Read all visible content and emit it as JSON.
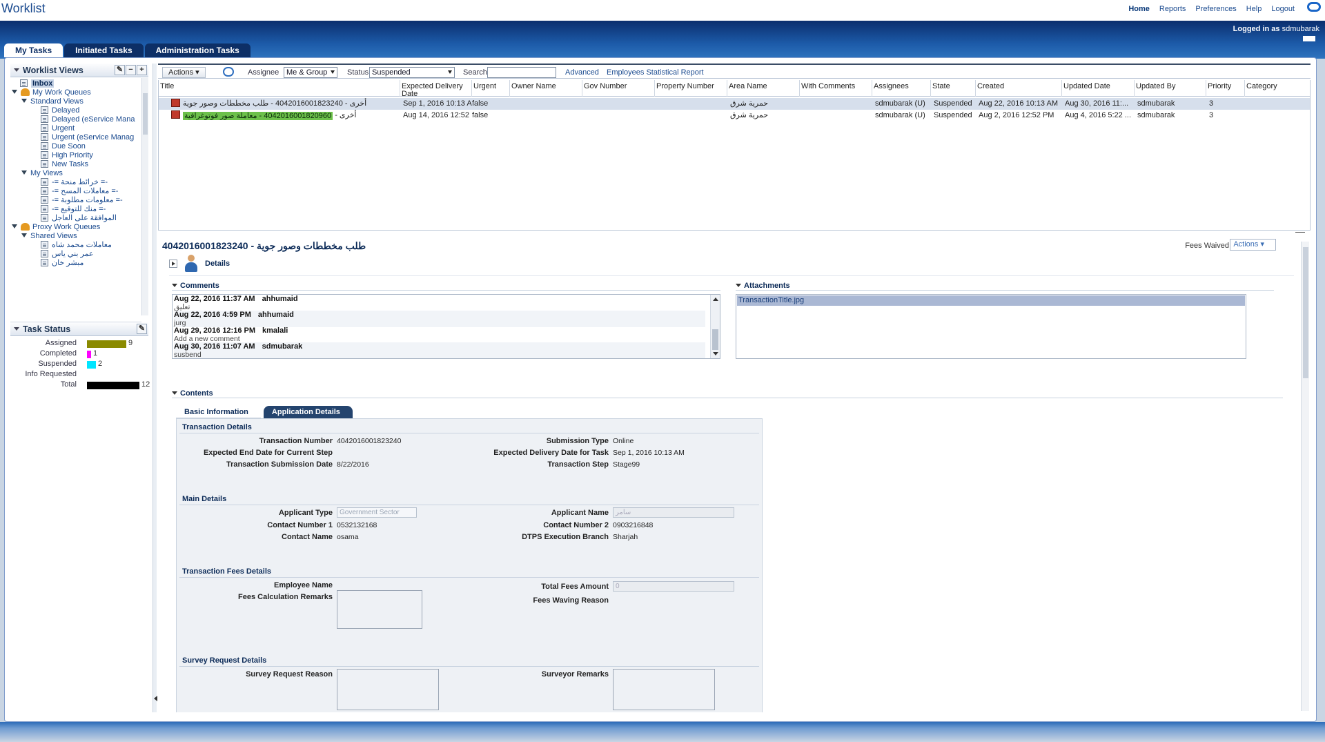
{
  "app": {
    "title": "Worklist",
    "top_links": [
      "Home",
      "Reports",
      "Preferences",
      "Help",
      "Logout"
    ],
    "logged_in_label": "Logged in as",
    "logged_in_user": "sdmubarak"
  },
  "main_tabs": [
    "My Tasks",
    "Initiated Tasks",
    "Administration Tasks"
  ],
  "worklist_views": {
    "title": "Worklist Views",
    "items": [
      {
        "label": "Inbox",
        "level": 1
      },
      {
        "label": "My Work Queues",
        "level": 0
      },
      {
        "label": "Standard Views",
        "level": 1
      },
      {
        "label": "Delayed",
        "level": 3
      },
      {
        "label": "Delayed (eService Mana",
        "level": 3
      },
      {
        "label": "Urgent",
        "level": 3
      },
      {
        "label": "Urgent (eService Manag",
        "level": 3
      },
      {
        "label": "Due Soon",
        "level": 3
      },
      {
        "label": "High Priority",
        "level": 3
      },
      {
        "label": "New Tasks",
        "level": 3
      },
      {
        "label": "My Views",
        "level": 1
      },
      {
        "label": "-= خرائط منحة =-",
        "level": 3
      },
      {
        "label": "-= معاملات المسح =-",
        "level": 3
      },
      {
        "label": "-= معلومات مطلوبة =-",
        "level": 3
      },
      {
        "label": "-= منك للتوقيع =-",
        "level": 3
      },
      {
        "label": "الموافقة على العاجل",
        "level": 3
      },
      {
        "label": "Proxy Work Queues",
        "level": 0
      },
      {
        "label": "Shared Views",
        "level": 1
      },
      {
        "label": "معاملات محمد شاه",
        "level": 3
      },
      {
        "label": "عمر بني ياس",
        "level": 3
      },
      {
        "label": "مبشر خان",
        "level": 3
      }
    ]
  },
  "task_status": {
    "title": "Task Status",
    "rows": [
      {
        "label": "Assigned",
        "count": "9",
        "color": "#8a8a00",
        "value": 9
      },
      {
        "label": "Completed",
        "count": "1",
        "color": "#ff00ff",
        "value": 1
      },
      {
        "label": "Suspended",
        "count": "2",
        "color": "#00e5ff",
        "value": 2
      },
      {
        "label": "Info Requested",
        "count": "",
        "color": "#000000",
        "value": 0
      },
      {
        "label": "Total",
        "count": "12",
        "color": "#000000",
        "value": 12
      }
    ]
  },
  "toolbar": {
    "actions_label": "Actions",
    "assignee_label": "Assignee",
    "assignee_value": "Me & Group",
    "status_label": "Status",
    "status_value": "Suspended",
    "search_label": "Search",
    "search_value": "",
    "advanced_link": "Advanced",
    "report_link": "Employees Statistical Report"
  },
  "task_table": {
    "columns": [
      "Title",
      "Expected Delivery Date",
      "Urgent",
      "Owner Name",
      "Gov Number",
      "Property Number",
      "Area Name",
      "With Comments",
      "Assignees",
      "State",
      "Created",
      "Updated Date",
      "Updated By",
      "Priority",
      "Category"
    ],
    "rows": [
      {
        "title_prefix": "أخرى",
        "title_main": "4042016001823240 - طلب مخططات وصور جوية",
        "expected": "Sep 1, 2016 10:13 AI",
        "urgent": "false",
        "area": "حمرية شرق",
        "assignees": "sdmubarak (U)",
        "state": "Suspended",
        "created": "Aug 22, 2016 10:13 AM",
        "updated": "Aug 30, 2016 11:...",
        "updated_by": "sdmubarak",
        "priority": "3"
      },
      {
        "title_prefix": "أخرى",
        "title_main": "4042016001820960 - معاملة صور فوتوغرافية",
        "expected": "Aug 14, 2016 12:52 I",
        "urgent": "false",
        "area": "حمرية شرق",
        "assignees": "sdmubarak (U)",
        "state": "Suspended",
        "created": "Aug 2, 2016 12:52 PM",
        "updated": "Aug 4, 2016 5:22 ...",
        "updated_by": "sdmubarak",
        "priority": "3"
      }
    ]
  },
  "detail": {
    "title": "4042016001823240 - طلب مخططات وصور جوية",
    "fees_waived_label": "Fees Waived",
    "actions_label": "Actions",
    "details_label": "Details",
    "comments_title": "Comments",
    "attachments_title": "Attachments",
    "comments": [
      {
        "date": "Aug 22, 2016 11:37 AM",
        "user": "ahhumaid",
        "text": "تعليق"
      },
      {
        "date": "Aug 22, 2016 4:59 PM",
        "user": "ahhumaid",
        "text": "jurg"
      },
      {
        "date": "Aug 29, 2016 12:16 PM",
        "user": "kmalali",
        "text": "Add a new comment"
      },
      {
        "date": "Aug 30, 2016 11:07 AM",
        "user": "sdmubarak",
        "text": "susbend"
      }
    ],
    "attachments": [
      "TransactionTitle.jpg"
    ],
    "contents_title": "Contents",
    "tabs": [
      "Basic Information",
      "Application Details"
    ]
  },
  "form": {
    "transaction_details": {
      "title": "Transaction Details",
      "transaction_number_label": "Transaction Number",
      "transaction_number": "4042016001823240",
      "submission_type_label": "Submission Type",
      "submission_type": "Online",
      "expected_end_label": "Expected End Date for Current Step",
      "expected_end": "",
      "expected_delivery_label": "Expected Delivery Date for Task",
      "expected_delivery": "Sep 1, 2016 10:13 AM",
      "submission_date_label": "Transaction Submission Date",
      "submission_date": "8/22/2016",
      "transaction_step_label": "Transaction Step",
      "transaction_step": "Stage99"
    },
    "main_details": {
      "title": "Main Details",
      "applicant_type_label": "Applicant Type",
      "applicant_type": "Government Sector",
      "applicant_name_label": "Applicant Name",
      "applicant_name": "سامر",
      "contact1_label": "Contact Number 1",
      "contact1": "0532132168",
      "contact2_label": "Contact Number 2",
      "contact2": "0903216848",
      "contact_name_label": "Contact Name",
      "contact_name": "osama",
      "branch_label": "DTPS Execution Branch",
      "branch": "Sharjah"
    },
    "fees": {
      "title": "Transaction Fees Details",
      "employee_label": "Employee Name",
      "total_fees_label": "Total Fees Amount",
      "total_fees": "0",
      "remarks_label": "Fees Calculation Remarks",
      "waiving_label": "Fees Waving Reason"
    },
    "survey": {
      "title": "Survey Request Details",
      "reason_label": "Survey Request Reason",
      "remarks_label": "Surveyor Remarks"
    }
  }
}
